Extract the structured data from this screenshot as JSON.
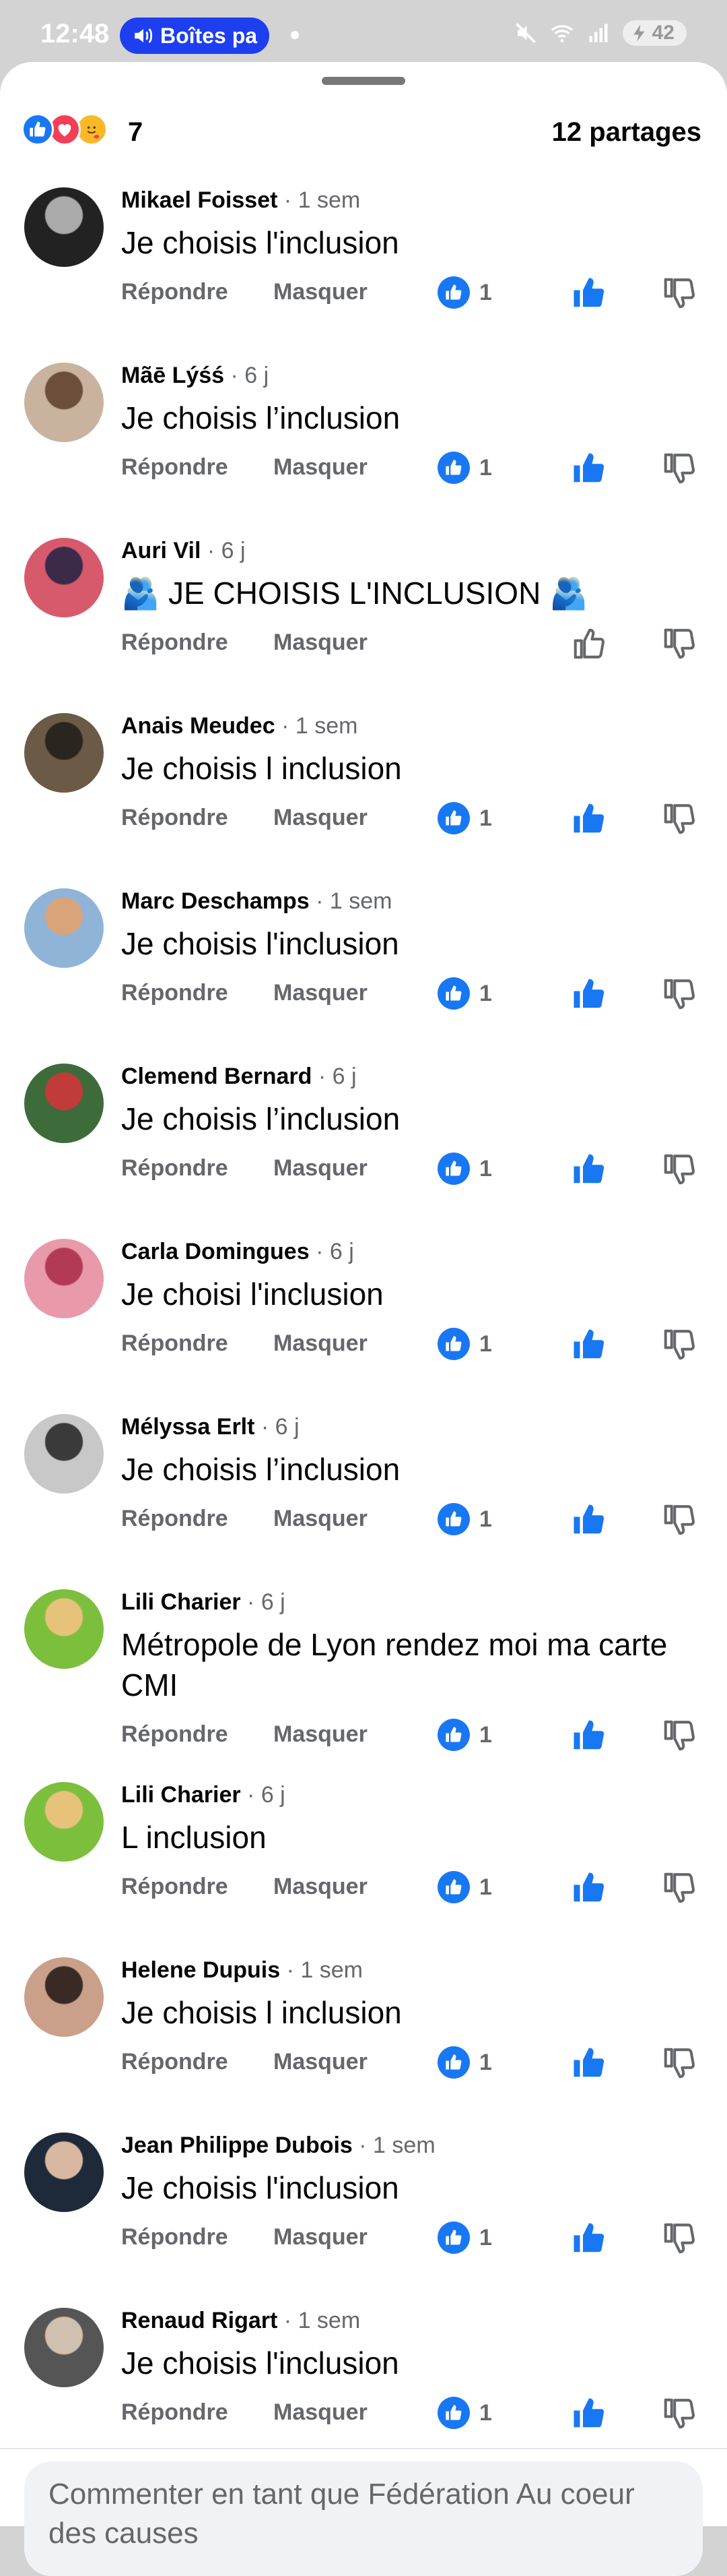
{
  "status": {
    "time": "12:48",
    "pill_label": "Boîtes pa",
    "battery": "42"
  },
  "reactions": {
    "count": "7",
    "shares": "12 partages",
    "icons": [
      "like-icon",
      "love-icon",
      "care-icon"
    ]
  },
  "labels": {
    "reply": "Répondre",
    "hide": "Masquer"
  },
  "colors": {
    "accent": "#1877f2",
    "love": "#f33e58",
    "care": "#f7b928",
    "muted": "#65676b"
  },
  "comments": [
    {
      "name": "Mikael Foisset",
      "time": " · 1 sem",
      "text": "Je choisis l'inclusion",
      "likes": "1",
      "liked": true
    },
    {
      "name": "Mãē Lýśś",
      "time": " · 6 j",
      "text": "Je choisis l’inclusion",
      "likes": "1",
      "liked": true
    },
    {
      "name": "Auri Vil",
      "time": " · 6 j",
      "text": "🫂 JE CHOISIS L'INCLUSION 🫂",
      "likes": "",
      "liked": false
    },
    {
      "name": "Anais Meudec",
      "time": " · 1 sem",
      "text": "Je choisis l inclusion",
      "likes": "1",
      "liked": true
    },
    {
      "name": "Marc Deschamps",
      "time": " · 1 sem",
      "text": "Je choisis l'inclusion",
      "likes": "1",
      "liked": true
    },
    {
      "name": "Clemend Bernard",
      "time": " · 6 j",
      "text": "Je choisis l’inclusion",
      "likes": "1",
      "liked": true
    },
    {
      "name": "Carla Domingues",
      "time": " · 6 j",
      "text": "Je choisi l'inclusion",
      "likes": "1",
      "liked": true
    },
    {
      "name": "Mélyssa Erlt",
      "time": " · 6 j",
      "text": "Je choisis l’inclusion",
      "likes": "1",
      "liked": true
    },
    {
      "name": "Lili Charier",
      "time": " · 6 j",
      "text": "Métropole de Lyon rendez moi ma carte CMI",
      "likes": "1",
      "liked": true
    },
    {
      "name": "Lili Charier",
      "time": " · 6 j",
      "text": "L inclusion",
      "likes": "1",
      "liked": true
    },
    {
      "name": "Helene Dupuis",
      "time": " · 1 sem",
      "text": "Je choisis l inclusion",
      "likes": "1",
      "liked": true
    },
    {
      "name": "Jean Philippe Dubois",
      "time": " · 1 sem",
      "text": "Je choisis l'inclusion",
      "likes": "1",
      "liked": true
    },
    {
      "name": "Renaud Rigart",
      "time": " · 1 sem",
      "text": "Je choisis l'inclusion",
      "likes": "1",
      "liked": true
    }
  ],
  "composer": {
    "placeholder": "Commenter en tant que Fédération Au coeur des causes"
  }
}
